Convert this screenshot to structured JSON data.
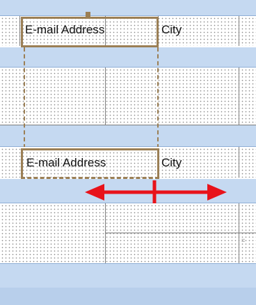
{
  "form": {
    "section1": {
      "field_label": "E-mail Address",
      "next_label": "City"
    },
    "section2": {
      "field_label": "E-mail Address",
      "next_label": "City"
    },
    "fragment_text": "="
  },
  "annotation": {
    "arrow_meaning": "resize-width",
    "arrow_color": "#e8131b",
    "selection_color": "#9b7f55"
  }
}
